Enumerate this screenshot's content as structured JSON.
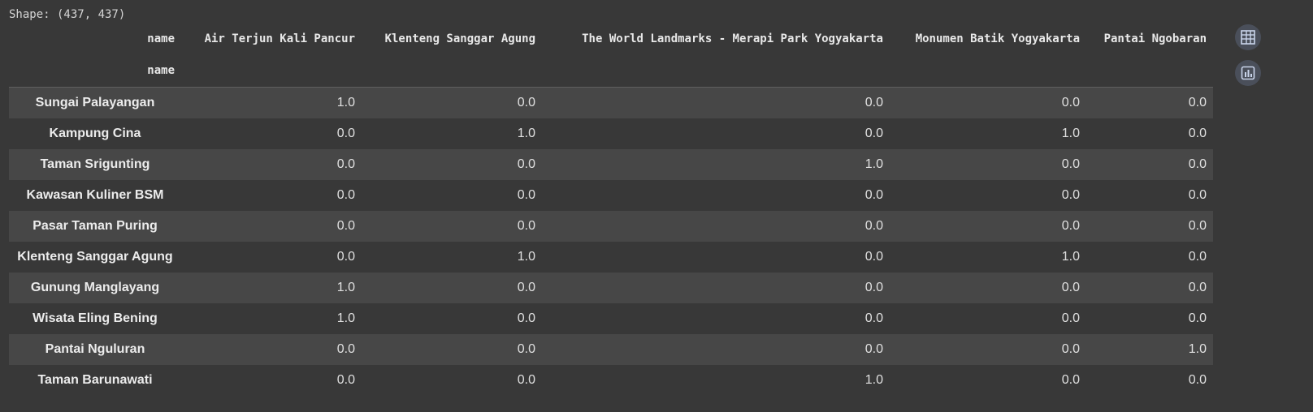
{
  "shape_text": "Shape: (437, 437)",
  "index_name": "name",
  "columns_label": "name",
  "columns": [
    "Air Terjun Kali Pancur",
    "Klenteng Sanggar Agung",
    "The World Landmarks - Merapi Park Yogyakarta",
    "Monumen Batik Yogyakarta",
    "Pantai Ngobaran"
  ],
  "rows": [
    {
      "name": "Sungai Palayangan",
      "values": [
        "1.0",
        "0.0",
        "0.0",
        "0.0",
        "0.0"
      ]
    },
    {
      "name": "Kampung Cina",
      "values": [
        "0.0",
        "1.0",
        "0.0",
        "1.0",
        "0.0"
      ]
    },
    {
      "name": "Taman Srigunting",
      "values": [
        "0.0",
        "0.0",
        "1.0",
        "0.0",
        "0.0"
      ]
    },
    {
      "name": "Kawasan Kuliner BSM",
      "values": [
        "0.0",
        "0.0",
        "0.0",
        "0.0",
        "0.0"
      ]
    },
    {
      "name": "Pasar Taman Puring",
      "values": [
        "0.0",
        "0.0",
        "0.0",
        "0.0",
        "0.0"
      ]
    },
    {
      "name": "Klenteng Sanggar Agung",
      "values": [
        "0.0",
        "1.0",
        "0.0",
        "1.0",
        "0.0"
      ]
    },
    {
      "name": "Gunung Manglayang",
      "values": [
        "1.0",
        "0.0",
        "0.0",
        "0.0",
        "0.0"
      ]
    },
    {
      "name": "Wisata Eling Bening",
      "values": [
        "1.0",
        "0.0",
        "0.0",
        "0.0",
        "0.0"
      ]
    },
    {
      "name": "Pantai Nguluran",
      "values": [
        "0.0",
        "0.0",
        "0.0",
        "0.0",
        "1.0"
      ]
    },
    {
      "name": "Taman Barunawati",
      "values": [
        "0.0",
        "0.0",
        "1.0",
        "0.0",
        "0.0"
      ]
    }
  ],
  "toolbar": {
    "table_icon": "table-icon",
    "chart_icon": "bar-chart-icon"
  }
}
